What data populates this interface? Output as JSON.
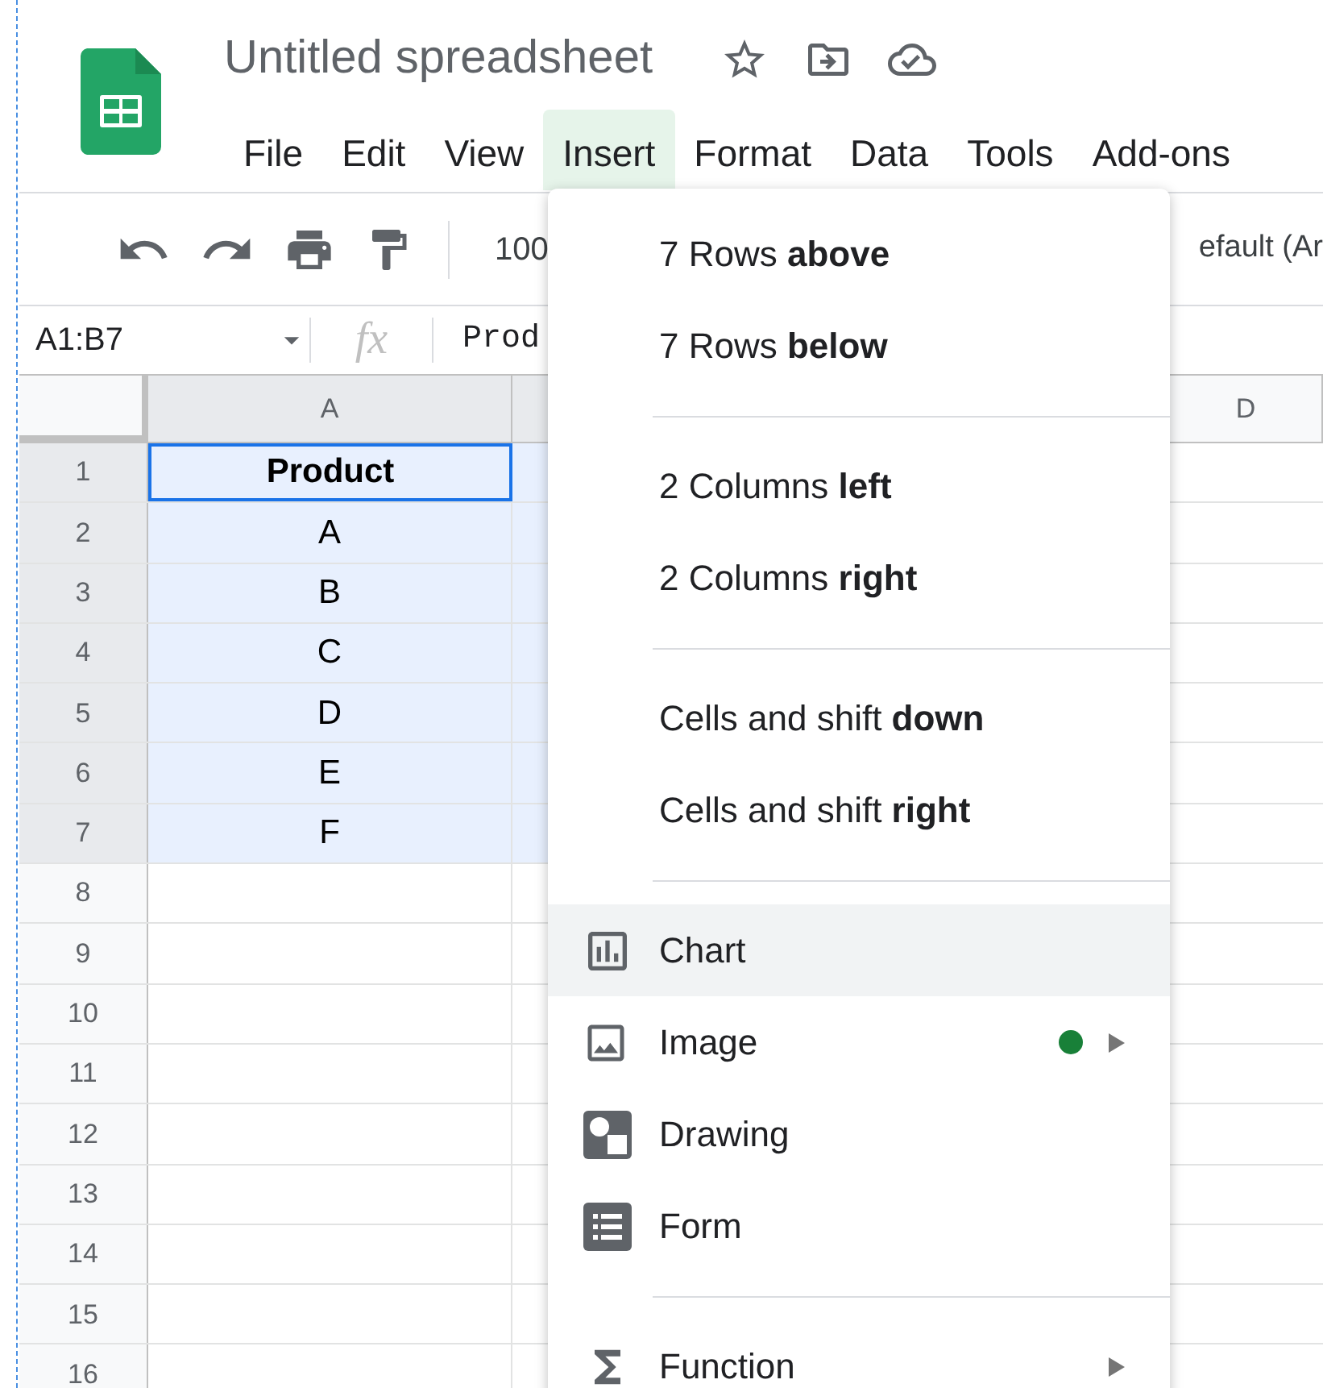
{
  "app": {
    "title": "Untitled spreadsheet",
    "menu": [
      {
        "label": "File",
        "selected": false
      },
      {
        "label": "Edit",
        "selected": false
      },
      {
        "label": "View",
        "selected": false
      },
      {
        "label": "Insert",
        "selected": true
      },
      {
        "label": "Format",
        "selected": false
      },
      {
        "label": "Data",
        "selected": false
      },
      {
        "label": "Tools",
        "selected": false
      },
      {
        "label": "Add-ons",
        "selected": false
      }
    ]
  },
  "toolbar": {
    "zoom": "100",
    "font": "efault (Ar"
  },
  "formula_bar": {
    "range": "A1:B7",
    "function_label": "fx",
    "formula": "Prod"
  },
  "sheet": {
    "columns": [
      {
        "label": "A",
        "selected": true
      },
      {
        "label": "D",
        "selected": false
      }
    ],
    "rows": [
      {
        "number": "1",
        "cell_a": "Product",
        "bold": true,
        "active": true,
        "selected": true
      },
      {
        "number": "2",
        "cell_a": "A",
        "bold": false,
        "active": false,
        "selected": true
      },
      {
        "number": "3",
        "cell_a": "B",
        "bold": false,
        "active": false,
        "selected": true
      },
      {
        "number": "4",
        "cell_a": "C",
        "bold": false,
        "active": false,
        "selected": true
      },
      {
        "number": "5",
        "cell_a": "D",
        "bold": false,
        "active": false,
        "selected": true
      },
      {
        "number": "6",
        "cell_a": "E",
        "bold": false,
        "active": false,
        "selected": true
      },
      {
        "number": "7",
        "cell_a": "F",
        "bold": false,
        "active": false,
        "selected": true
      },
      {
        "number": "8",
        "active": false,
        "selected": false
      },
      {
        "number": "9",
        "active": false,
        "selected": false
      },
      {
        "number": "10",
        "active": false,
        "selected": false
      },
      {
        "number": "11",
        "active": false,
        "selected": false
      },
      {
        "number": "12",
        "active": false,
        "selected": false
      },
      {
        "number": "13",
        "active": false,
        "selected": false
      },
      {
        "number": "14",
        "active": false,
        "selected": false
      },
      {
        "number": "15",
        "active": false,
        "selected": false
      },
      {
        "number": "16",
        "active": false,
        "selected": false
      }
    ]
  },
  "insert_menu": {
    "groups": [
      [
        {
          "label": "7 Rows **above**",
          "kind": "plain",
          "selected": false,
          "submenu": false,
          "new_dot": false
        },
        {
          "label": "7 Rows **below**",
          "kind": "plain",
          "selected": false,
          "submenu": false,
          "new_dot": false
        }
      ],
      [
        {
          "label": "2 Columns **left**",
          "kind": "plain",
          "selected": false,
          "submenu": false,
          "new_dot": false
        },
        {
          "label": "2 Columns **right**",
          "kind": "plain",
          "selected": false,
          "submenu": false,
          "new_dot": false
        }
      ],
      [
        {
          "label": "Cells and shift **down**",
          "kind": "plain",
          "selected": false,
          "submenu": false,
          "new_dot": false
        },
        {
          "label": "Cells and shift **right**",
          "kind": "plain",
          "selected": false,
          "submenu": false,
          "new_dot": false
        }
      ],
      [
        {
          "label": "Chart",
          "kind": "chart",
          "selected": true,
          "submenu": false,
          "new_dot": false
        },
        {
          "label": "Image",
          "kind": "image",
          "selected": false,
          "submenu": true,
          "new_dot": true
        },
        {
          "label": "Drawing",
          "kind": "drawing",
          "selected": false,
          "submenu": false,
          "new_dot": false
        },
        {
          "label": "Form",
          "kind": "form",
          "selected": false,
          "submenu": false,
          "new_dot": false
        }
      ],
      [
        {
          "label": "Function",
          "kind": "function",
          "selected": false,
          "submenu": true,
          "new_dot": false
        }
      ]
    ]
  }
}
